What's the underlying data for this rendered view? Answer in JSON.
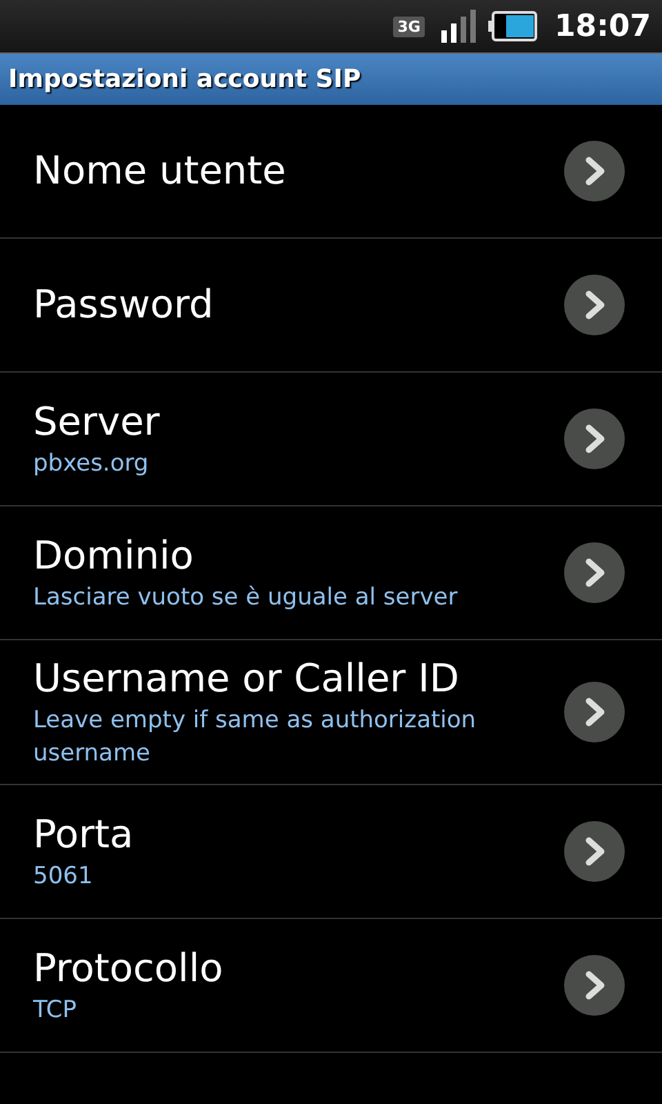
{
  "status_bar": {
    "network": "3G",
    "time": "18:07"
  },
  "title": "Impostazioni account SIP",
  "items": [
    {
      "title": "Nome utente"
    },
    {
      "title": "Password"
    },
    {
      "title": "Server",
      "summary": "pbxes.org"
    },
    {
      "title": "Dominio",
      "summary": "Lasciare vuoto se è uguale al server"
    },
    {
      "title": "Username or Caller ID",
      "summary": "Leave empty if same as authorization username"
    },
    {
      "title": "Porta",
      "summary": "5061"
    },
    {
      "title": "Protocollo",
      "summary": "TCP"
    }
  ]
}
